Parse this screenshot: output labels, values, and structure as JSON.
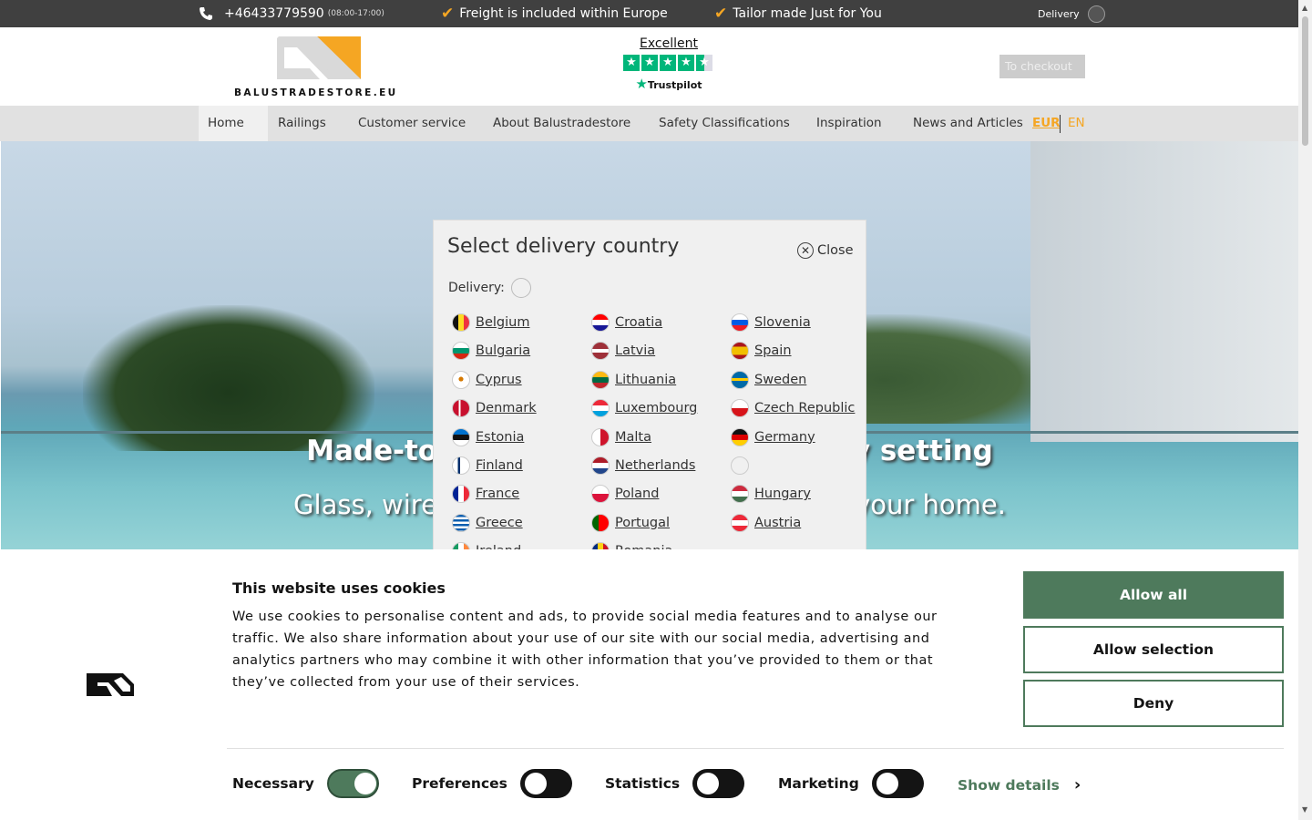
{
  "topbar": {
    "phone": "+46433779590",
    "hours": "(08:00-17:00)",
    "feature1": "Freight is included within Europe",
    "feature2": "Tailor made Just for You",
    "delivery_label": "Delivery"
  },
  "header": {
    "brand": "BALUSTRADESTORE.EU",
    "trustpilot_rating": "Excellent",
    "trustpilot_name": "Trustpilot",
    "trustpilot_stars": 4.5,
    "checkout_label": "To checkout"
  },
  "nav": {
    "items": [
      "Home",
      "Railings",
      "Customer service",
      "About Balustradestore",
      "Safety Classifications",
      "Inspiration",
      "News and Articles"
    ],
    "currency": "EUR",
    "language": "EN"
  },
  "hero": {
    "headline": "Made-to-measure railings for every setting",
    "subline": "Glass, wire and steel railings designed for your home."
  },
  "modal": {
    "title": "Select delivery country",
    "close_label": "Close",
    "delivery_label": "Delivery:",
    "columns": [
      [
        "Belgium",
        "Bulgaria",
        "Cyprus",
        "Denmark",
        "Estonia",
        "Finland",
        "France",
        "Greece",
        "Ireland"
      ],
      [
        "Croatia",
        "Latvia",
        "Lithuania",
        "Luxembourg",
        "Malta",
        "Netherlands",
        "Poland",
        "Portugal",
        "Romania"
      ],
      [
        "Slovenia",
        "Spain",
        "Sweden",
        "Czech Republic",
        "Germany",
        "",
        "Hungary",
        "Austria"
      ]
    ]
  },
  "cookie": {
    "title": "This website uses cookies",
    "text": "We use cookies to personalise content and ads, to provide social media features and to analyse our traffic. We also share information about your use of our site with our social media, advertising and analytics partners who may combine it with other information that you’ve provided to them or that they’ve collected from your use of their services.",
    "allow_all": "Allow all",
    "allow_selection": "Allow selection",
    "deny": "Deny",
    "toggles": [
      {
        "label": "Necessary",
        "on": true
      },
      {
        "label": "Preferences",
        "on": false
      },
      {
        "label": "Statistics",
        "on": false
      },
      {
        "label": "Marketing",
        "on": false
      }
    ],
    "show_details": "Show details"
  },
  "colors": {
    "accent": "#f5a623",
    "cookie_green": "#4e7a5c",
    "topbar": "#404040",
    "nav": "#e1e1e1"
  }
}
